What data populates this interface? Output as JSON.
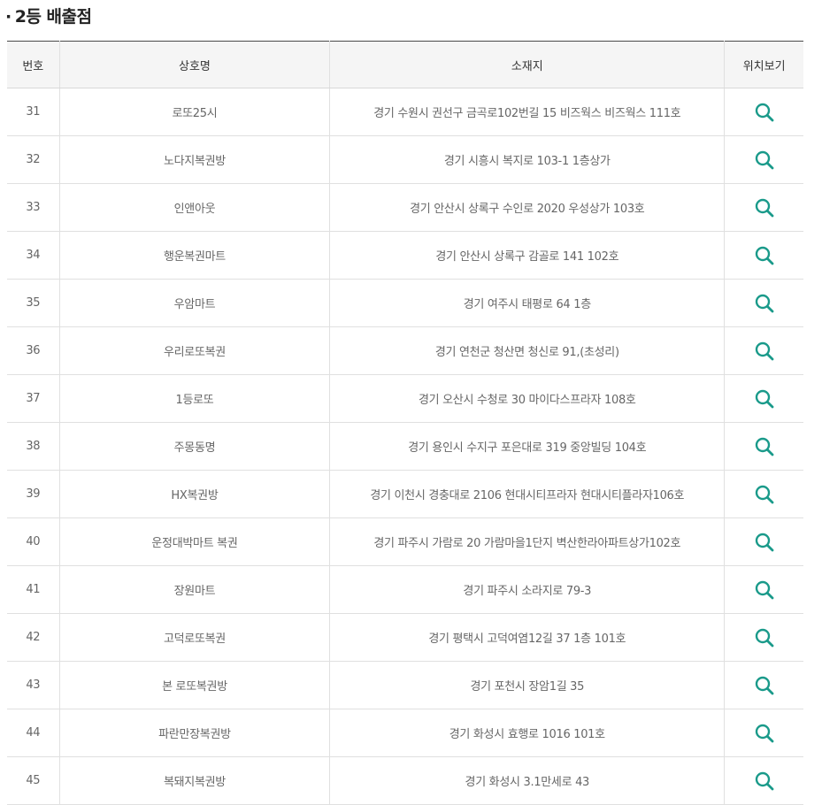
{
  "section": {
    "bullet": "·",
    "title": "2등 배출점"
  },
  "columns": {
    "no": "번호",
    "name": "상호명",
    "address": "소재지",
    "map": "위치보기"
  },
  "accent_color": "#1a9a8a",
  "icon": "search-icon",
  "rows": [
    {
      "no": "31",
      "name": "로또25시",
      "address": "경기 수원시 권선구 금곡로102번길 15 비즈웍스 비즈웍스 111호"
    },
    {
      "no": "32",
      "name": "노다지복권방",
      "address": "경기 시흥시 복지로 103-1 1층상가"
    },
    {
      "no": "33",
      "name": "인앤아웃",
      "address": "경기 안산시 상록구 수인로 2020 우성상가 103호"
    },
    {
      "no": "34",
      "name": "행운복권마트",
      "address": "경기 안산시 상록구 감골로 141 102호"
    },
    {
      "no": "35",
      "name": "우암마트",
      "address": "경기 여주시 태평로 64 1층"
    },
    {
      "no": "36",
      "name": "우리로또복권",
      "address": "경기 연천군 청산면 청신로 91,(초성리)"
    },
    {
      "no": "37",
      "name": "1등로또",
      "address": "경기 오산시 수청로 30 마이다스프라자 108호"
    },
    {
      "no": "38",
      "name": "주몽동명",
      "address": "경기 용인시 수지구 포은대로 319 중앙빌딩 104호"
    },
    {
      "no": "39",
      "name": "HX복권방",
      "address": "경기 이천시 경충대로 2106 현대시티프라자 현대시티플라자106호"
    },
    {
      "no": "40",
      "name": "운정대박마트 복권",
      "address": "경기 파주시 가람로 20 가람마을1단지 벽산한라아파트상가102호"
    },
    {
      "no": "41",
      "name": "장원마트",
      "address": "경기 파주시 소라지로 79-3"
    },
    {
      "no": "42",
      "name": "고덕로또복권",
      "address": "경기 평택시 고덕여염12길 37 1층 101호"
    },
    {
      "no": "43",
      "name": "본 로또복권방",
      "address": "경기 포천시 장암1길 35"
    },
    {
      "no": "44",
      "name": "파란만장복권방",
      "address": "경기 화성시 효행로 1016 101호"
    },
    {
      "no": "45",
      "name": "복돼지복권방",
      "address": "경기 화성시 3.1만세로 43"
    }
  ]
}
